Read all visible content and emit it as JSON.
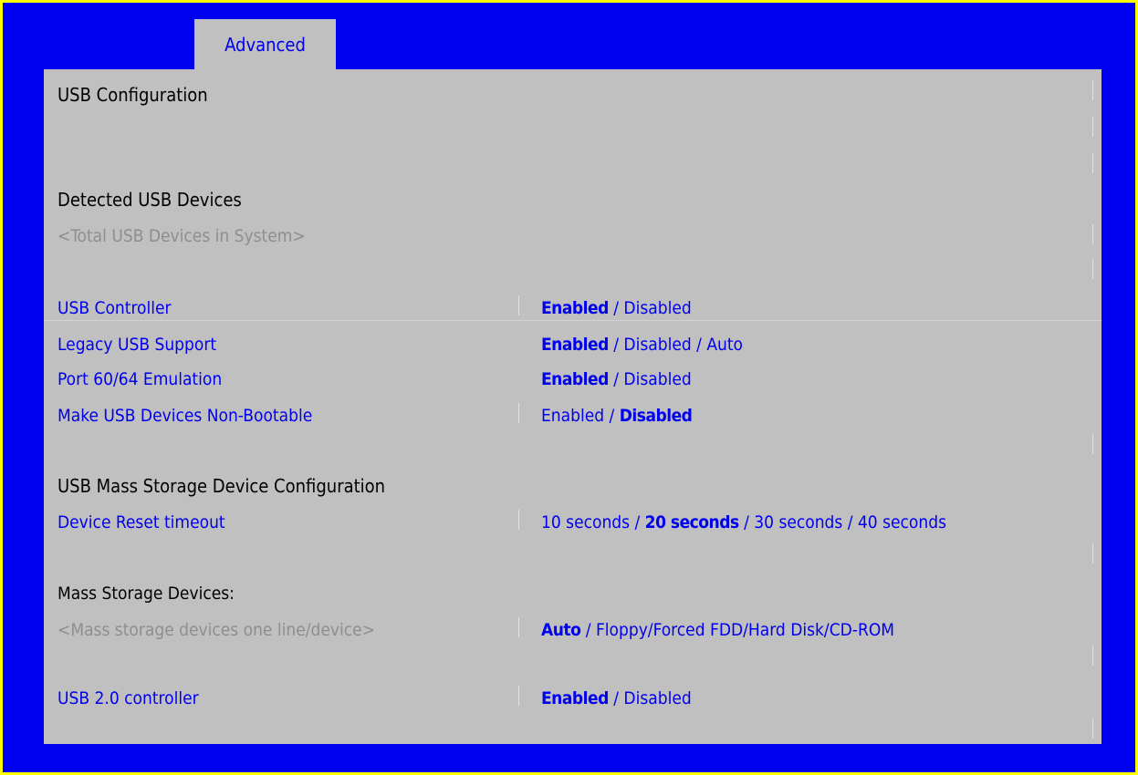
{
  "tabs": [
    {
      "label": "Advanced"
    }
  ],
  "page_title": "USB Configuration",
  "sections": {
    "detected_heading": "Detected USB Devices",
    "total_devices": "<Total USB Devices in System>",
    "mass_storage_heading": "USB Mass Storage Device Configuration",
    "mass_storage_devices_label": "Mass Storage Devices:",
    "mass_storage_devices_placeholder": "<Mass storage devices one line/device>"
  },
  "settings": {
    "usb_controller": {
      "label": "USB Controller",
      "selected": "Enabled",
      "rest": " / Disabled"
    },
    "legacy_usb": {
      "label": "Legacy USB Support",
      "selected": "Enabled",
      "rest": " / Disabled / Auto"
    },
    "port_emulation": {
      "label": "Port 60/64 Emulation",
      "selected": "Enabled",
      "rest": " / Disabled"
    },
    "non_bootable": {
      "label": "Make USB Devices Non-Bootable",
      "before": "Enabled / ",
      "selected": "Disabled"
    },
    "reset_timeout": {
      "label": "Device Reset timeout",
      "before": "10 seconds / ",
      "selected": "20 seconds",
      "rest": " / 30 seconds / 40 seconds"
    },
    "mass_storage_type": {
      "selected": "Auto",
      "rest": " / Floppy/Forced FDD/Hard Disk/CD-ROM"
    },
    "usb2_controller": {
      "label": "USB 2.0 controller",
      "selected": "Enabled",
      "rest": " / Disabled"
    }
  },
  "colors": {
    "background_blue": "#0000f0",
    "border_yellow": "#ffff00",
    "panel_gray": "#c0c0c0",
    "option_blue": "#0000ee",
    "disabled_gray": "#8e8e8e"
  }
}
